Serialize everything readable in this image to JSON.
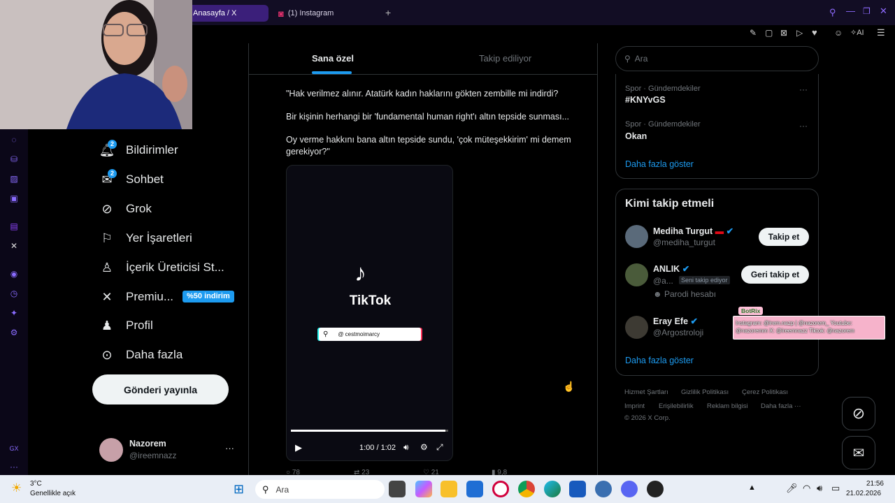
{
  "browser": {
    "tabs": [
      {
        "label": "Anasayfa / X"
      },
      {
        "label": "(1) Instagram"
      }
    ],
    "new_tab": "+",
    "ai_label": "AI"
  },
  "nav": {
    "items": [
      {
        "label": "Bildirimler",
        "badge": "2"
      },
      {
        "label": "Sohbet",
        "badge": "2"
      },
      {
        "label": "Grok"
      },
      {
        "label": "Yer İşaretleri"
      },
      {
        "label": "İçerik Üreticisi St..."
      },
      {
        "label": "Premiu...",
        "badge_text": "%50 indirim"
      },
      {
        "label": "Profil"
      },
      {
        "label": "Daha fazla"
      }
    ],
    "post_button": "Gönderi yayınla",
    "user": {
      "name": "Nazorem",
      "handle": "@ireemnazz",
      "more": "···"
    }
  },
  "main": {
    "tabs": [
      {
        "label": "Sana özel"
      },
      {
        "label": "Takip ediliyor"
      }
    ],
    "tweet": {
      "lines": [
        "\"Hak verilmez alınır. Atatürk kadın haklarını gökten zembille mi indirdi?",
        "Bir kişinin herhangi bir 'fundamental human right'ı altın tepside sunması...",
        "Oy verme hakkını bana altın tepside sundu, 'çok müteşekkirim' mi demem gerekiyor?\""
      ],
      "video": {
        "brand": "TikTok",
        "username": "@ cestmoimarcy",
        "time": "1:00 / 1:02",
        "progress": 0.98
      },
      "actions": [
        "78",
        "23",
        "21",
        "9,8"
      ]
    }
  },
  "right": {
    "search_placeholder": "Ara",
    "trends": [
      {
        "meta": "Spor · Gündemdekiler",
        "title": "#KNYvGS"
      },
      {
        "meta": "Spor · Gündemdekiler",
        "title": "Okan"
      }
    ],
    "trend_more": "Daha fazla göster",
    "who_to_follow": {
      "title": "Kimi takip etmeli",
      "users": [
        {
          "name": "Mediha Turgut",
          "handle": "@mediha_turgut",
          "button": "Takip et"
        },
        {
          "name": "ANLIK",
          "handle": "@a...",
          "follows_you": "Seni takip ediyor",
          "note": "Parodi hesabı",
          "button": "Geri takip et"
        },
        {
          "name": "Eray Efe",
          "handle": "@Argostroloji"
        }
      ],
      "more": "Daha fazla göster"
    },
    "footer": [
      "Hizmet Şartları",
      "Gizlilik Politikası",
      "Çerez Politikası",
      "Imprint",
      "Erişilebilirlik",
      "Reklam bilgisi",
      "Daha fazla ···",
      "© 2026 X Corp."
    ]
  },
  "overlay": {
    "bot_label": "BotRix",
    "text": "Instagram: @irem.nazp | @nazorem_ Youtube: @nazoremm X: @ireemnazz Tiktok: @nazorem"
  },
  "taskbar": {
    "weather_temp": "3°C",
    "weather_desc": "Genellikle açık",
    "search": "Ara",
    "time": "21:56",
    "date": "21.02.2026"
  },
  "colors": {
    "accent": "#1d9bf0",
    "opera": "#8f6bff",
    "background": "#000000"
  }
}
